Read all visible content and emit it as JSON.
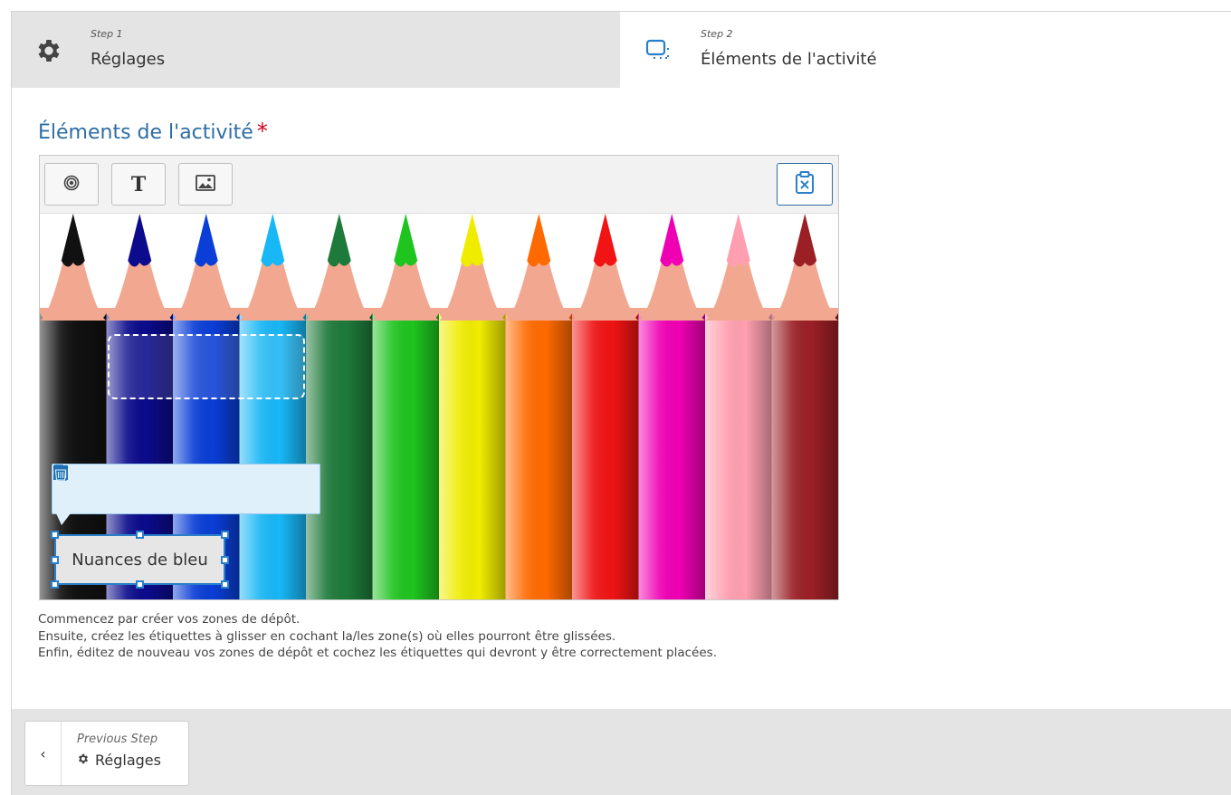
{
  "steps": [
    {
      "number_label": "Step 1",
      "title": "Réglages",
      "icon": "gear-icon"
    },
    {
      "number_label": "Step 2",
      "title": "Éléments de l'activité",
      "icon": "dropzone-icon"
    }
  ],
  "section": {
    "title": "Éléments de l'activité",
    "required_mark": "*"
  },
  "toolbar": {
    "tools": [
      "target-icon",
      "text-icon",
      "image-icon"
    ],
    "clear_tool": "clipboard-clear-icon"
  },
  "popover": {
    "actions": [
      "resize-icon",
      "edit-icon",
      "duplicate-icon",
      "bring-front-icon",
      "send-back-icon",
      "delete-icon"
    ]
  },
  "label": {
    "text": "Nuances de bleu"
  },
  "pencils": {
    "colors": [
      "#111111",
      "#0b0b8c",
      "#0a3ed6",
      "#18b7f6",
      "#1e7a3a",
      "#1fc41f",
      "#f0ec00",
      "#ff6a00",
      "#f01414",
      "#f000b4",
      "#ff9fb0",
      "#9a2026"
    ]
  },
  "instructions": [
    "Commencez par créer vos zones de dépôt.",
    "Ensuite, créez les étiquettes à glisser en cochant la/les zone(s) où elles pourront être glissées.",
    "Enfin, éditez de nouveau vos zones de dépôt et cochez les étiquettes qui devront y être correctement placées."
  ],
  "footer": {
    "prev_small": "Previous Step",
    "prev_title": "Réglages"
  }
}
